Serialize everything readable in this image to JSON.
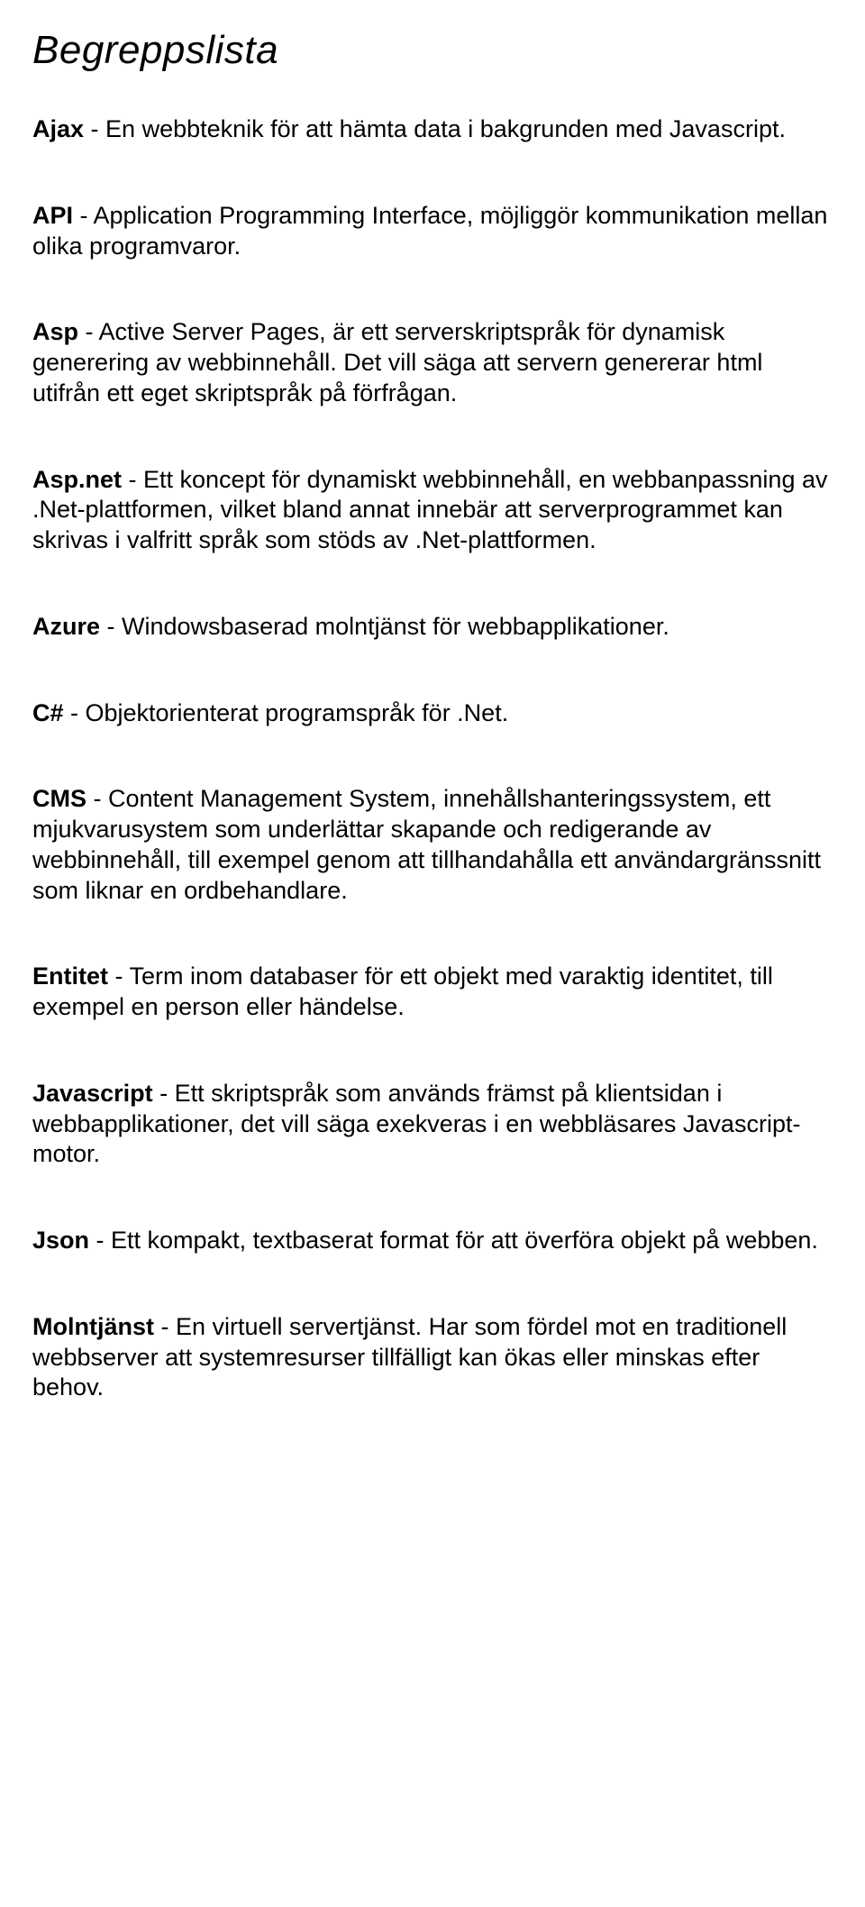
{
  "title": "Begreppslista",
  "entries": [
    {
      "term": "Ajax",
      "definition": " - En webbteknik för att hämta data i bakgrunden med Javascript."
    },
    {
      "term": "API",
      "definition": " - Application Programming Interface, möjliggör kommunikation mellan olika programvaror."
    },
    {
      "term": "Asp",
      "definition": " - Active Server Pages, är ett serverskriptspråk för dynamisk generering av webbinnehåll. Det vill säga att servern genererar html utifrån ett eget skriptspråk på förfrågan."
    },
    {
      "term": "Asp.net",
      "definition": " - Ett koncept för dynamiskt webbinnehåll, en webbanpassning av .Net-plattformen, vilket bland annat innebär att serverprogrammet kan skrivas i valfritt språk som stöds av .Net-plattformen."
    },
    {
      "term": "Azure",
      "definition": " - Windowsbaserad molntjänst för webbapplikationer."
    },
    {
      "term": "C#",
      "definition": " - Objektorienterat programspråk för .Net."
    },
    {
      "term": "CMS",
      "definition": " - Content Management System, innehållshanteringssystem, ett mjukvarusystem som underlättar skapande och redigerande av webbinnehåll, till exempel genom att tillhandahålla ett användargränssnitt som liknar en ordbehandlare."
    },
    {
      "term": "Entitet",
      "definition": " - Term inom databaser för ett objekt med varaktig identitet, till exempel en person eller händelse."
    },
    {
      "term": "Javascript",
      "definition": " - Ett skriptspråk som används främst på klientsidan i webbapplikationer, det vill säga exekveras i en webbläsares Javascript-motor."
    },
    {
      "term": "Json",
      "definition": " - Ett kompakt, textbaserat format för att överföra objekt på webben."
    },
    {
      "term": "Molntjänst",
      "definition": " - En virtuell servertjänst. Har som fördel mot en traditionell webbserver att systemresurser tillfälligt kan ökas eller minskas efter behov."
    }
  ]
}
